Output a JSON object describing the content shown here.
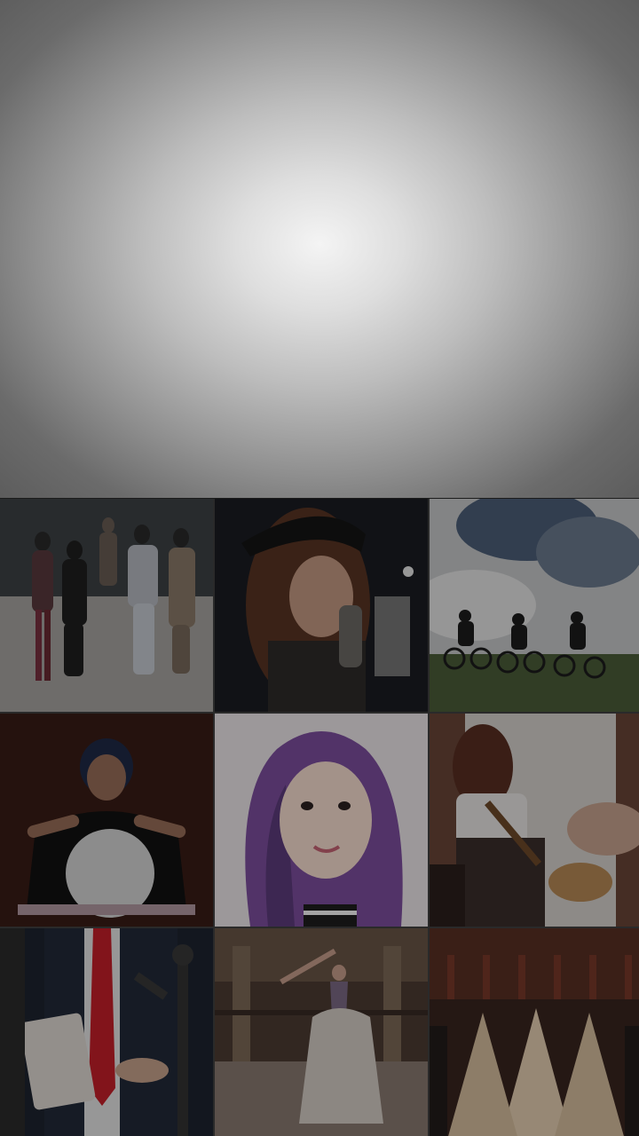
{
  "screen": {
    "hero_state": "loading"
  },
  "grid": {
    "tiles": [
      {
        "icon": "photo-runway-models"
      },
      {
        "icon": "photo-singer-microphone"
      },
      {
        "icon": "photo-mountain-bikers"
      },
      {
        "icon": "photo-fortune-teller-crystal-ball"
      },
      {
        "icon": "photo-purple-hair-selfie"
      },
      {
        "icon": "photo-woman-ukulele"
      },
      {
        "icon": "photo-press-microphones-suit"
      },
      {
        "icon": "photo-ballet-dancer"
      },
      {
        "icon": "photo-banquet-hall"
      }
    ]
  },
  "colors": {
    "hero_center": "#f4f4f4",
    "hero_edge": "#5a5a5a",
    "overlay": "#000000"
  }
}
